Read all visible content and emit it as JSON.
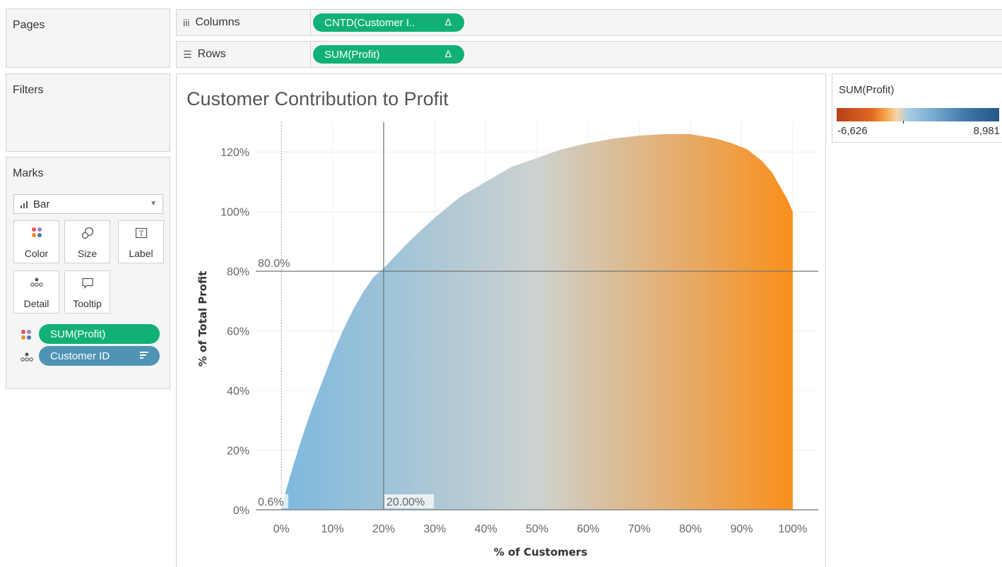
{
  "shelves": {
    "pages_label": "Pages",
    "filters_label": "Filters",
    "columns_label": "Columns",
    "columns_pill": "CNTD(Customer I..",
    "rows_label": "Rows",
    "rows_pill": "SUM(Profit)",
    "delta_symbol": "Δ"
  },
  "marks": {
    "title": "Marks",
    "type": "Bar",
    "buttons": [
      {
        "label": "Color",
        "icon": "color-dots-icon"
      },
      {
        "label": "Size",
        "icon": "size-shape-icon"
      },
      {
        "label": "Label",
        "icon": "text-label-icon"
      },
      {
        "label": "Detail",
        "icon": "detail-dots-icon"
      },
      {
        "label": "Tooltip",
        "icon": "tooltip-bubble-icon"
      }
    ],
    "fields": [
      {
        "label": "SUM(Profit)",
        "color": "#11b077",
        "icon": "color-dots-icon"
      },
      {
        "label": "Customer ID",
        "color": "#4f94b5",
        "icon": "detail-dots-icon"
      }
    ]
  },
  "legend": {
    "title": "SUM(Profit)",
    "min_label": "-6,626",
    "max_label": "8,981",
    "colors": {
      "negative": "#b6401b",
      "mid": "#f6d6a8",
      "positive": "#245787"
    }
  },
  "chart_data": {
    "type": "area",
    "title": "Customer Contribution to Profit",
    "xlabel": "% of Customers",
    "ylabel": "% of Total Profit",
    "xlim": [
      -5,
      105
    ],
    "ylim": [
      0,
      130
    ],
    "x_ticks": [
      "0%",
      "10%",
      "20%",
      "30%",
      "40%",
      "50%",
      "60%",
      "70%",
      "80%",
      "90%",
      "100%"
    ],
    "y_ticks": [
      "0%",
      "20%",
      "40%",
      "60%",
      "80%",
      "100%",
      "120%"
    ],
    "x": [
      0,
      1,
      2,
      4,
      6,
      8,
      10,
      12,
      14,
      16,
      18,
      20,
      25,
      30,
      35,
      40,
      45,
      50,
      55,
      60,
      65,
      70,
      75,
      80,
      85,
      88,
      91,
      94,
      96,
      98,
      99,
      100
    ],
    "y": [
      0.6,
      7,
      13,
      24,
      34,
      43,
      52,
      60,
      67,
      73,
      78,
      81,
      90,
      98,
      105,
      110,
      115,
      118,
      121,
      123,
      124.5,
      125.5,
      126,
      126,
      124.5,
      123,
      121,
      117,
      113,
      107,
      104,
      100
    ],
    "reference_lines": [
      {
        "axis": "y",
        "value": 80,
        "label": "80.0%"
      },
      {
        "axis": "x",
        "value": 20,
        "label": "20.00%"
      },
      {
        "axis": "x",
        "value": 0,
        "label": "0.6%"
      }
    ],
    "gradient": {
      "start": "#7db8de",
      "middle": "#cdd2d0",
      "end": "#f98f1c"
    },
    "grid": true
  }
}
